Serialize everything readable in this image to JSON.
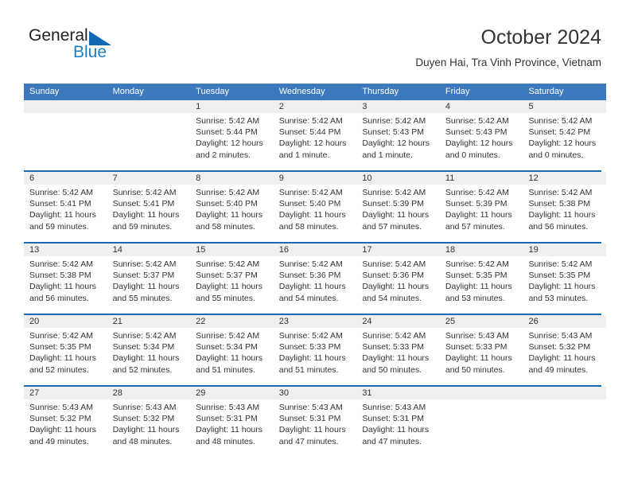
{
  "brand": {
    "name_part1": "General",
    "name_part2": "Blue",
    "triangle_color": "#1268b3",
    "blue_color": "#1a80c4"
  },
  "header": {
    "title": "October 2024",
    "location": "Duyen Hai, Tra Vinh Province, Vietnam"
  },
  "theme": {
    "header_blue": "#3c78bc",
    "rule_blue": "#1f69b3",
    "date_band_gray": "#efefef",
    "text": "#333333"
  },
  "weekdays": [
    "Sunday",
    "Monday",
    "Tuesday",
    "Wednesday",
    "Thursday",
    "Friday",
    "Saturday"
  ],
  "weeks": [
    [
      {
        "day": "",
        "lines": []
      },
      {
        "day": "",
        "lines": []
      },
      {
        "day": "1",
        "lines": [
          "Sunrise: 5:42 AM",
          "Sunset: 5:44 PM",
          "Daylight: 12 hours",
          "and 2 minutes."
        ]
      },
      {
        "day": "2",
        "lines": [
          "Sunrise: 5:42 AM",
          "Sunset: 5:44 PM",
          "Daylight: 12 hours",
          "and 1 minute."
        ]
      },
      {
        "day": "3",
        "lines": [
          "Sunrise: 5:42 AM",
          "Sunset: 5:43 PM",
          "Daylight: 12 hours",
          "and 1 minute."
        ]
      },
      {
        "day": "4",
        "lines": [
          "Sunrise: 5:42 AM",
          "Sunset: 5:43 PM",
          "Daylight: 12 hours",
          "and 0 minutes."
        ]
      },
      {
        "day": "5",
        "lines": [
          "Sunrise: 5:42 AM",
          "Sunset: 5:42 PM",
          "Daylight: 12 hours",
          "and 0 minutes."
        ]
      }
    ],
    [
      {
        "day": "6",
        "lines": [
          "Sunrise: 5:42 AM",
          "Sunset: 5:41 PM",
          "Daylight: 11 hours",
          "and 59 minutes."
        ]
      },
      {
        "day": "7",
        "lines": [
          "Sunrise: 5:42 AM",
          "Sunset: 5:41 PM",
          "Daylight: 11 hours",
          "and 59 minutes."
        ]
      },
      {
        "day": "8",
        "lines": [
          "Sunrise: 5:42 AM",
          "Sunset: 5:40 PM",
          "Daylight: 11 hours",
          "and 58 minutes."
        ]
      },
      {
        "day": "9",
        "lines": [
          "Sunrise: 5:42 AM",
          "Sunset: 5:40 PM",
          "Daylight: 11 hours",
          "and 58 minutes."
        ]
      },
      {
        "day": "10",
        "lines": [
          "Sunrise: 5:42 AM",
          "Sunset: 5:39 PM",
          "Daylight: 11 hours",
          "and 57 minutes."
        ]
      },
      {
        "day": "11",
        "lines": [
          "Sunrise: 5:42 AM",
          "Sunset: 5:39 PM",
          "Daylight: 11 hours",
          "and 57 minutes."
        ]
      },
      {
        "day": "12",
        "lines": [
          "Sunrise: 5:42 AM",
          "Sunset: 5:38 PM",
          "Daylight: 11 hours",
          "and 56 minutes."
        ]
      }
    ],
    [
      {
        "day": "13",
        "lines": [
          "Sunrise: 5:42 AM",
          "Sunset: 5:38 PM",
          "Daylight: 11 hours",
          "and 56 minutes."
        ]
      },
      {
        "day": "14",
        "lines": [
          "Sunrise: 5:42 AM",
          "Sunset: 5:37 PM",
          "Daylight: 11 hours",
          "and 55 minutes."
        ]
      },
      {
        "day": "15",
        "lines": [
          "Sunrise: 5:42 AM",
          "Sunset: 5:37 PM",
          "Daylight: 11 hours",
          "and 55 minutes."
        ]
      },
      {
        "day": "16",
        "lines": [
          "Sunrise: 5:42 AM",
          "Sunset: 5:36 PM",
          "Daylight: 11 hours",
          "and 54 minutes."
        ]
      },
      {
        "day": "17",
        "lines": [
          "Sunrise: 5:42 AM",
          "Sunset: 5:36 PM",
          "Daylight: 11 hours",
          "and 54 minutes."
        ]
      },
      {
        "day": "18",
        "lines": [
          "Sunrise: 5:42 AM",
          "Sunset: 5:35 PM",
          "Daylight: 11 hours",
          "and 53 minutes."
        ]
      },
      {
        "day": "19",
        "lines": [
          "Sunrise: 5:42 AM",
          "Sunset: 5:35 PM",
          "Daylight: 11 hours",
          "and 53 minutes."
        ]
      }
    ],
    [
      {
        "day": "20",
        "lines": [
          "Sunrise: 5:42 AM",
          "Sunset: 5:35 PM",
          "Daylight: 11 hours",
          "and 52 minutes."
        ]
      },
      {
        "day": "21",
        "lines": [
          "Sunrise: 5:42 AM",
          "Sunset: 5:34 PM",
          "Daylight: 11 hours",
          "and 52 minutes."
        ]
      },
      {
        "day": "22",
        "lines": [
          "Sunrise: 5:42 AM",
          "Sunset: 5:34 PM",
          "Daylight: 11 hours",
          "and 51 minutes."
        ]
      },
      {
        "day": "23",
        "lines": [
          "Sunrise: 5:42 AM",
          "Sunset: 5:33 PM",
          "Daylight: 11 hours",
          "and 51 minutes."
        ]
      },
      {
        "day": "24",
        "lines": [
          "Sunrise: 5:42 AM",
          "Sunset: 5:33 PM",
          "Daylight: 11 hours",
          "and 50 minutes."
        ]
      },
      {
        "day": "25",
        "lines": [
          "Sunrise: 5:43 AM",
          "Sunset: 5:33 PM",
          "Daylight: 11 hours",
          "and 50 minutes."
        ]
      },
      {
        "day": "26",
        "lines": [
          "Sunrise: 5:43 AM",
          "Sunset: 5:32 PM",
          "Daylight: 11 hours",
          "and 49 minutes."
        ]
      }
    ],
    [
      {
        "day": "27",
        "lines": [
          "Sunrise: 5:43 AM",
          "Sunset: 5:32 PM",
          "Daylight: 11 hours",
          "and 49 minutes."
        ]
      },
      {
        "day": "28",
        "lines": [
          "Sunrise: 5:43 AM",
          "Sunset: 5:32 PM",
          "Daylight: 11 hours",
          "and 48 minutes."
        ]
      },
      {
        "day": "29",
        "lines": [
          "Sunrise: 5:43 AM",
          "Sunset: 5:31 PM",
          "Daylight: 11 hours",
          "and 48 minutes."
        ]
      },
      {
        "day": "30",
        "lines": [
          "Sunrise: 5:43 AM",
          "Sunset: 5:31 PM",
          "Daylight: 11 hours",
          "and 47 minutes."
        ]
      },
      {
        "day": "31",
        "lines": [
          "Sunrise: 5:43 AM",
          "Sunset: 5:31 PM",
          "Daylight: 11 hours",
          "and 47 minutes."
        ]
      },
      {
        "day": "",
        "lines": []
      },
      {
        "day": "",
        "lines": []
      }
    ]
  ]
}
